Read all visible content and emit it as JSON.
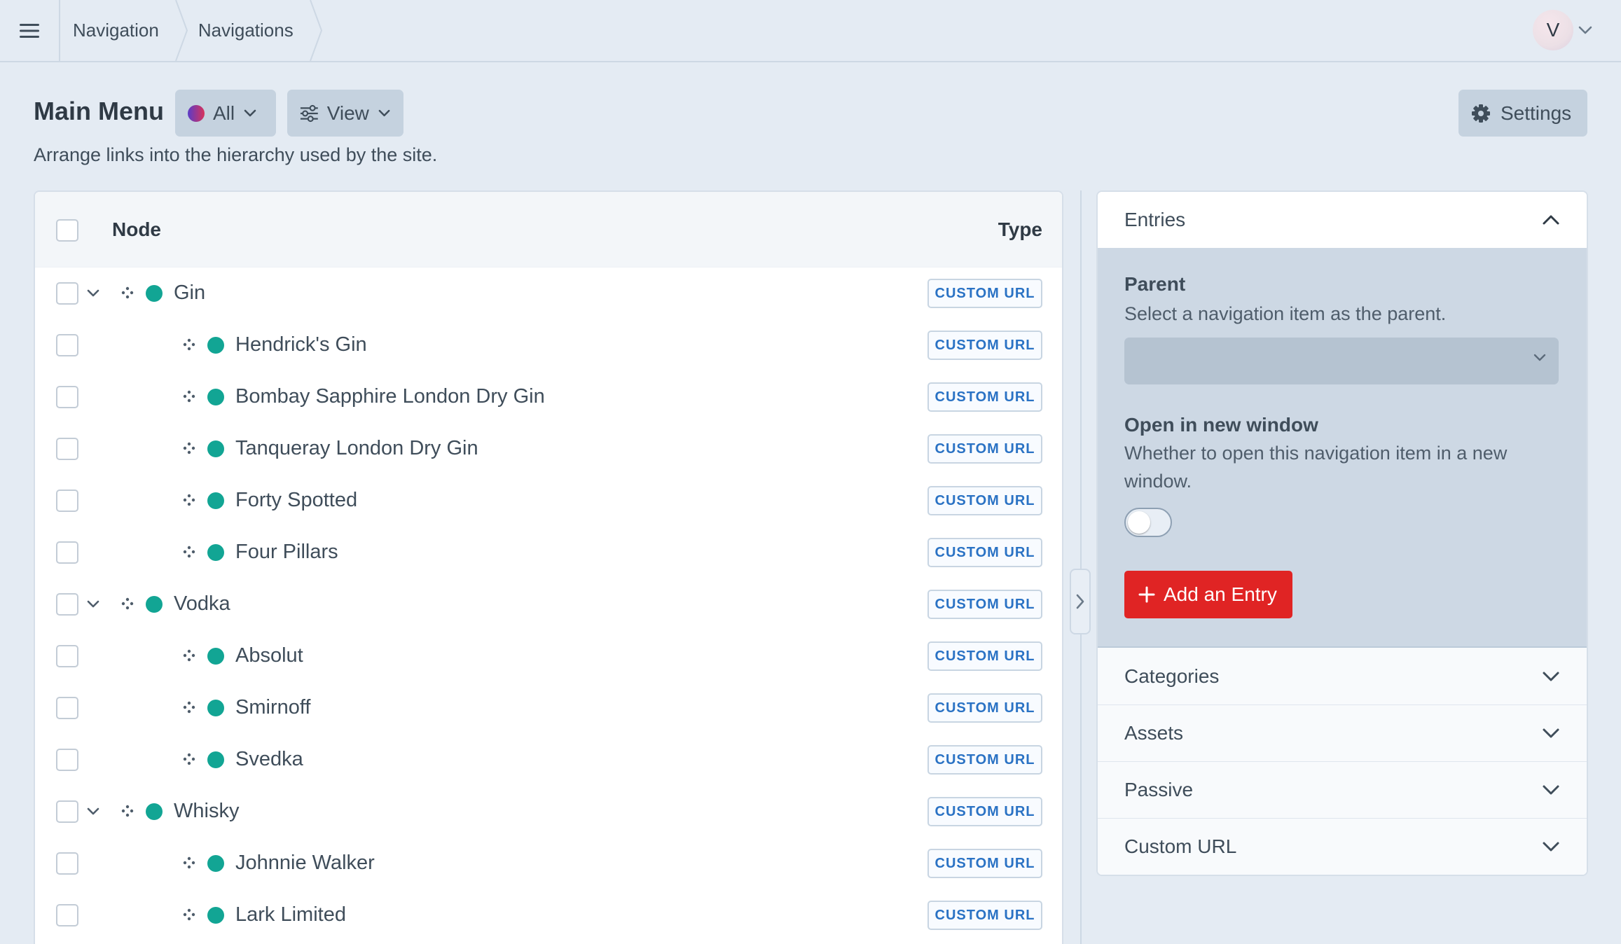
{
  "topbar": {
    "menu_icon": "hamburger-icon",
    "breadcrumbs": [
      "Navigation",
      "Navigations"
    ],
    "avatar_initial": "V"
  },
  "header": {
    "title": "Main Menu",
    "site_filter_label": "All",
    "view_label": "View",
    "settings_label": "Settings",
    "description": "Arrange links into the hierarchy used by the site."
  },
  "tree": {
    "columns": {
      "node": "Node",
      "type": "Type"
    },
    "rows": [
      {
        "label": "Gin",
        "type": "CUSTOM URL",
        "level": 0,
        "expandable": true
      },
      {
        "label": "Hendrick's Gin",
        "type": "CUSTOM URL",
        "level": 1
      },
      {
        "label": "Bombay Sapphire London Dry Gin",
        "type": "CUSTOM URL",
        "level": 1
      },
      {
        "label": "Tanqueray London Dry Gin",
        "type": "CUSTOM URL",
        "level": 1
      },
      {
        "label": "Forty Spotted",
        "type": "CUSTOM URL",
        "level": 1
      },
      {
        "label": "Four Pillars",
        "type": "CUSTOM URL",
        "level": 1
      },
      {
        "label": "Vodka",
        "type": "CUSTOM URL",
        "level": 0,
        "expandable": true
      },
      {
        "label": "Absolut",
        "type": "CUSTOM URL",
        "level": 1
      },
      {
        "label": "Smirnoff",
        "type": "CUSTOM URL",
        "level": 1
      },
      {
        "label": "Svedka",
        "type": "CUSTOM URL",
        "level": 1
      },
      {
        "label": "Whisky",
        "type": "CUSTOM URL",
        "level": 0,
        "expandable": true
      },
      {
        "label": "Johnnie Walker",
        "type": "CUSTOM URL",
        "level": 1
      },
      {
        "label": "Lark Limited",
        "type": "CUSTOM URL",
        "level": 1
      }
    ]
  },
  "sidebar": {
    "entries": {
      "title": "Entries",
      "parent_label": "Parent",
      "parent_help": "Select a navigation item as the parent.",
      "parent_value": "",
      "new_window_label": "Open in new window",
      "new_window_help": "Whether to open this navigation item in a new window.",
      "new_window_on": false,
      "add_button": "Add an Entry"
    },
    "sections": [
      "Categories",
      "Assets",
      "Passive",
      "Custom URL"
    ]
  },
  "colors": {
    "status_enabled": "#12a594",
    "add_button": "#e02424",
    "badge_text": "#2a72c4"
  }
}
